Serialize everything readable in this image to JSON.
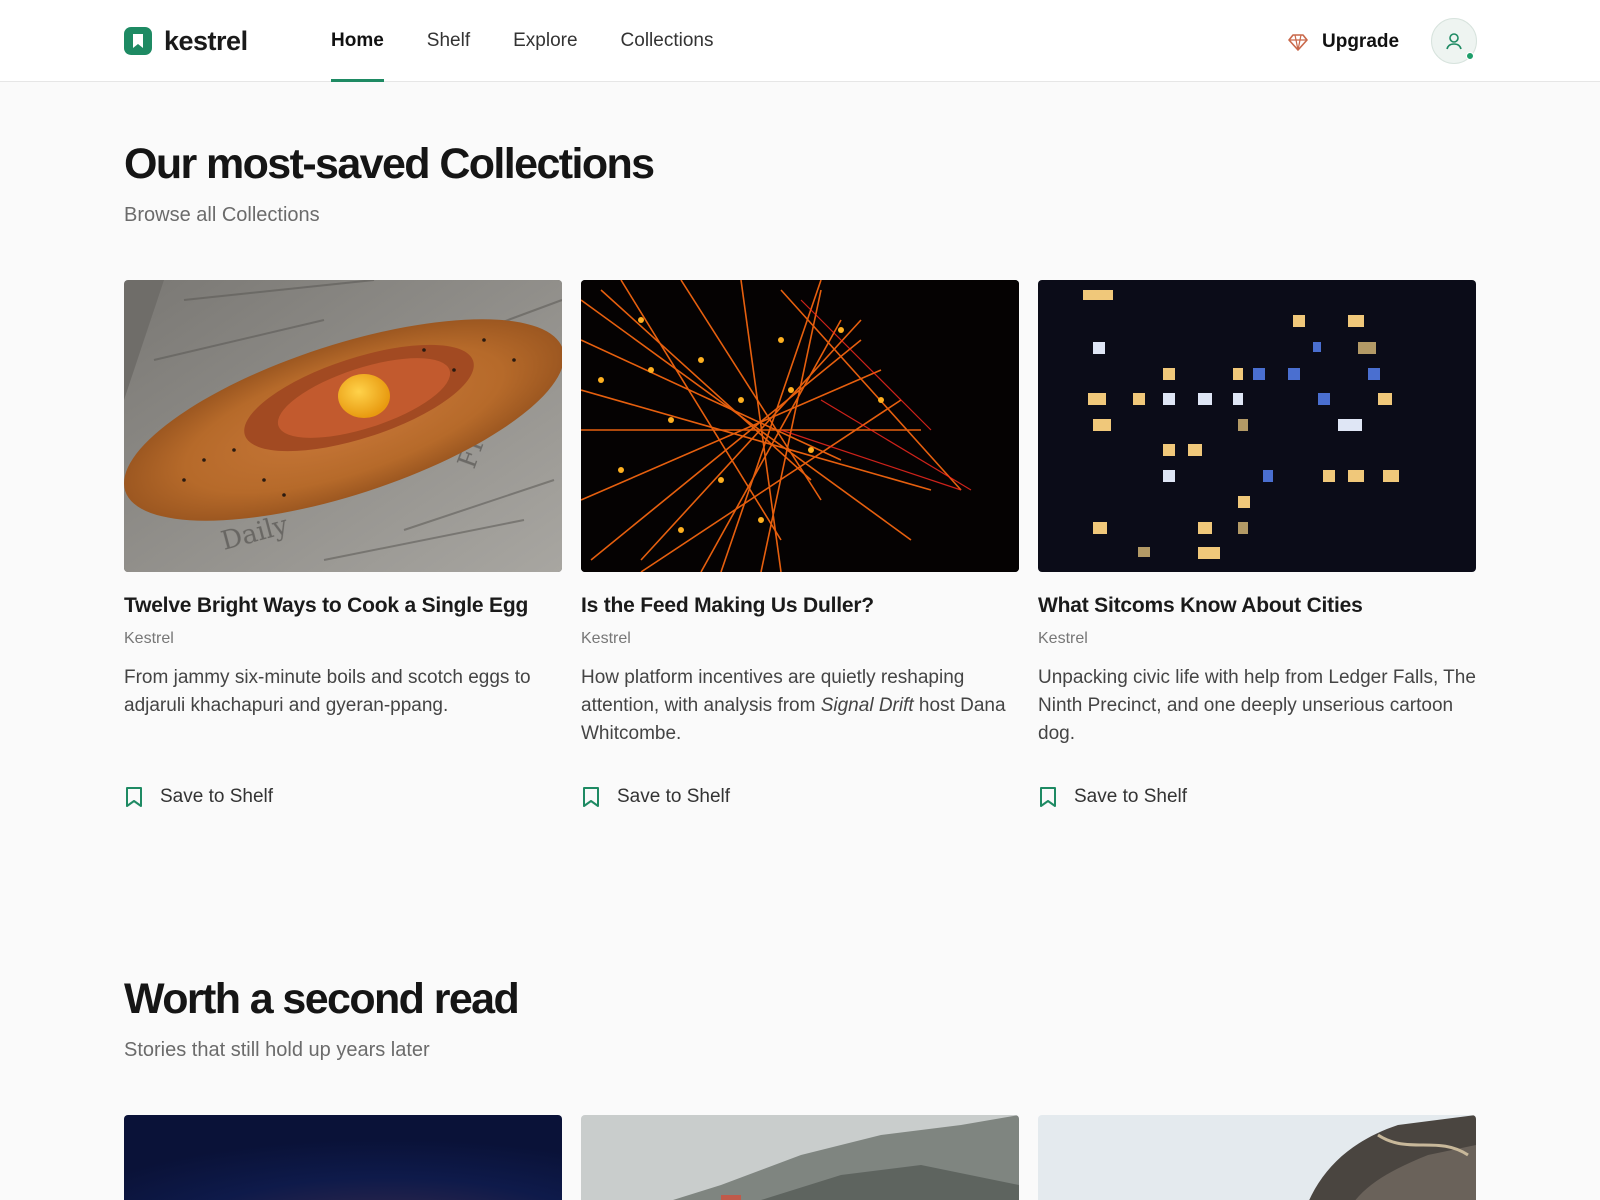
{
  "header": {
    "logo_text": "kestrel",
    "nav": [
      {
        "label": "Home",
        "active": true
      },
      {
        "label": "Shelf",
        "active": false
      },
      {
        "label": "Explore",
        "active": false
      },
      {
        "label": "Collections",
        "active": false
      }
    ],
    "upgrade_label": "Upgrade"
  },
  "colors": {
    "accent": "#1e8a63",
    "upgrade_icon": "#c9684a"
  },
  "section1": {
    "title": "Our most-saved Collections",
    "subtitle": "Browse all Collections",
    "cards": [
      {
        "title": "Twelve Bright Ways to Cook a Single Egg",
        "author": "Kestrel",
        "desc_pre": "From jammy six-minute boils and scotch eggs to adjaruli khachapuri and gyeran-ppang.",
        "desc_italic": "",
        "desc_post": "",
        "save_label": "Save to Shelf",
        "image": "khachapuri-bread"
      },
      {
        "title": "Is the Feed Making Us Duller?",
        "author": "Kestrel",
        "desc_pre": "How platform incentives are quietly reshaping attention, with analysis from ",
        "desc_italic": "Signal Drift",
        "desc_post": " host Dana Whitcombe.",
        "save_label": "Save to Shelf",
        "image": "orange-network-lines"
      },
      {
        "title": "What Sitcoms Know About Cities",
        "author": "Kestrel",
        "desc_pre": "Unpacking civic life with help from Ledger Falls, The Ninth Precinct, and one deeply unserious cartoon dog.",
        "desc_italic": "",
        "desc_post": "",
        "save_label": "Save to Shelf",
        "image": "night-building-windows"
      }
    ]
  },
  "section2": {
    "title": "Worth a second read",
    "subtitle": "Stories that still hold up years later",
    "images": [
      "night-sky",
      "misty-hillside",
      "rocky-tree"
    ]
  }
}
